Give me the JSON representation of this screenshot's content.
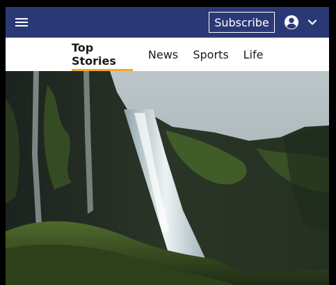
{
  "header": {
    "menu_icon": "hamburger-menu-icon",
    "subscribe_label": "Subscribe",
    "account_icon": "account-circle-icon",
    "dropdown_icon": "chevron-down-icon",
    "bar_color": "#2a3976"
  },
  "tabs": [
    {
      "label": "Top Stories",
      "active": true
    },
    {
      "label": "News",
      "active": false
    },
    {
      "label": "Sports",
      "active": false
    },
    {
      "label": "Life",
      "active": false
    }
  ],
  "accent_color": "#f5a623",
  "hero": {
    "image": "waterfall-cliff-photo"
  }
}
